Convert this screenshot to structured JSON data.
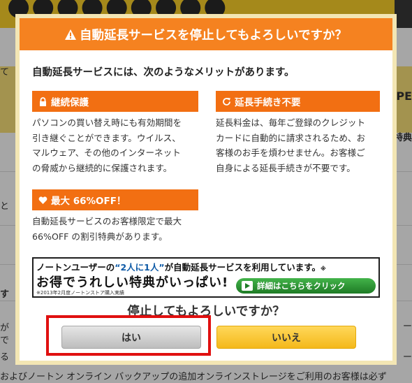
{
  "background": {
    "left_fragments": [
      "て",
      "と",
      "す",
      "が",
      "で",
      "る"
    ],
    "right_fragments": [
      "PE",
      "特典",
      "ー",
      "ー"
    ],
    "bottom_line": "およびノートン オンライン バックアップの追加オンラインストレージをご利用のお客様は必ず"
  },
  "dialog": {
    "title": "自動延長サービスを停止してもよろしいですか？",
    "intro": "自動延長サービスには、次のようなメリットがあります。",
    "benefits": [
      {
        "icon": "lock-icon",
        "title": "継続保護",
        "lines": [
          "パソコンの買い替え時にも有効期間を",
          "引き継ぐことができます。ウイルス、",
          "マルウェア、その他のインターネット",
          "の脅威から継続的に保護されます。"
        ]
      },
      {
        "icon": "refresh-icon",
        "title": "延長手続き不要",
        "lines": [
          "延長料金は、毎年ご登録のクレジット",
          "カードに自動的に請求されるため、お",
          "客様のお手を煩わせません。お客様ご",
          "自身による延長手続きが不要です。"
        ]
      },
      {
        "icon": "heart-icon",
        "title": "最大 66%OFF！",
        "lines": [
          "自動延長サービスのお客様限定で最大",
          "66%OFF の割引特典があります。"
        ]
      }
    ],
    "ad": {
      "line1_pre": "ノートンユーザーの",
      "line1_highlight": "“2人に1人”",
      "line1_post": "が自動延長サービスを利用しています。",
      "line1_mark": "※",
      "line2": "お得でうれしい特典がいっぱい!",
      "note": "※2013年2月度ノートンストア購入実績",
      "button_label": "詳細はこちらをクリック"
    },
    "question": "停止してもよろしいですか？",
    "yes_label": "はい",
    "no_label": "いいえ"
  },
  "colors": {
    "header": "#f58220",
    "benefit_header": "#f26f12",
    "highlight_box": "#e01010",
    "yes_button": "#cfcfcf",
    "no_button": "#f9c22e"
  }
}
